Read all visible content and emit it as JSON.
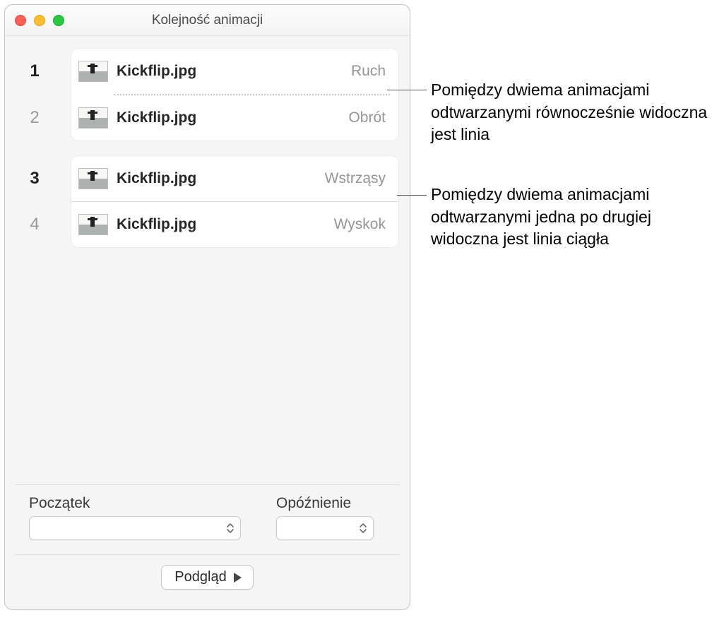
{
  "window": {
    "title": "Kolejność animacji"
  },
  "rows": {
    "0": {
      "num": "1",
      "file": "Kickflip.jpg",
      "effect": "Ruch"
    },
    "1": {
      "num": "2",
      "file": "Kickflip.jpg",
      "effect": "Obrót"
    },
    "2": {
      "num": "3",
      "file": "Kickflip.jpg",
      "effect": "Wstrząsy"
    },
    "3": {
      "num": "4",
      "file": "Kickflip.jpg",
      "effect": "Wyskok"
    }
  },
  "footer": {
    "start_label": "Początek",
    "delay_label": "Opóźnienie",
    "preview_label": "Podgląd"
  },
  "callouts": {
    "c1": "Pomiędzy dwiema animacjami odtwarzanymi równocześnie widoczna jest linia",
    "c2": "Pomiędzy dwiema animacjami odtwarzanymi jedna po drugiej widoczna jest linia ciągła"
  }
}
